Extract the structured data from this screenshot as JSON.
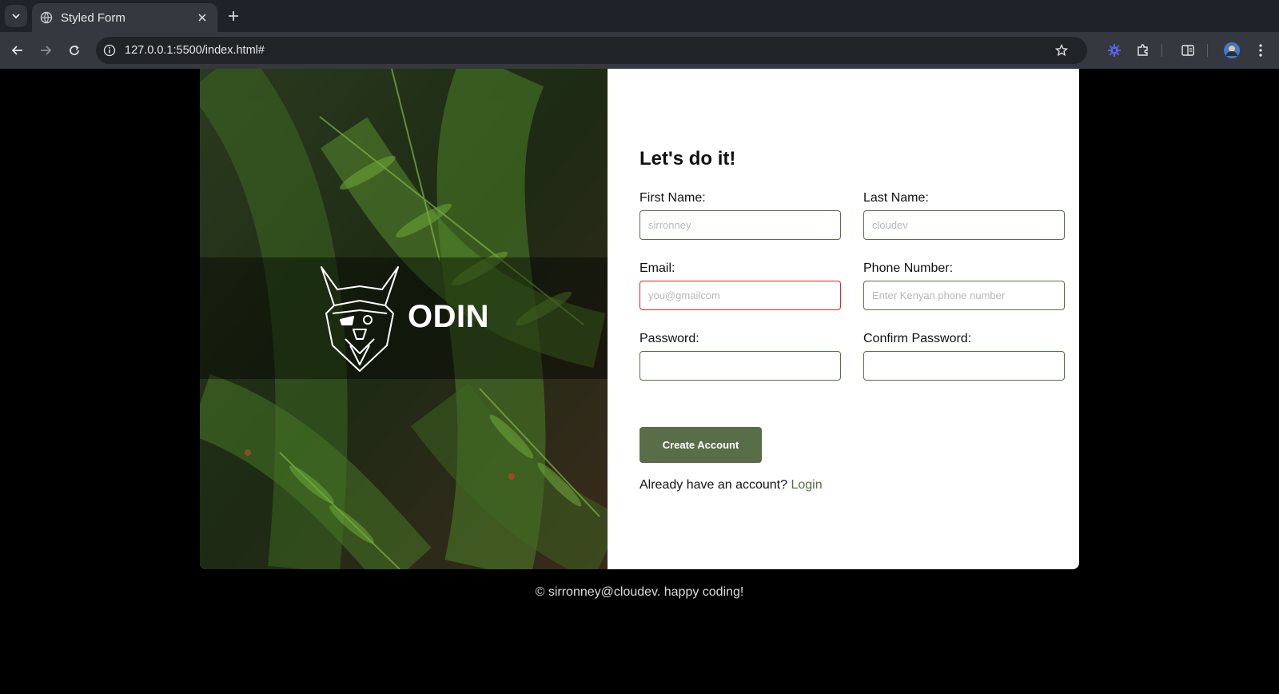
{
  "browser": {
    "tab_title": "Styled Form",
    "url": "127.0.0.1:5500/index.html#"
  },
  "hero": {
    "brand": "ODIN"
  },
  "form": {
    "heading": "Let's do it!",
    "fields": {
      "first_name": {
        "label": "First Name:",
        "placeholder": "sirronney",
        "value": ""
      },
      "last_name": {
        "label": "Last Name:",
        "placeholder": "cloudev",
        "value": ""
      },
      "email": {
        "label": "Email:",
        "placeholder": "you@gmailcom",
        "value": "",
        "state": "invalid"
      },
      "phone": {
        "label": "Phone Number:",
        "placeholder": "Enter Kenyan phone number",
        "value": ""
      },
      "password": {
        "label": "Password:",
        "placeholder": "",
        "value": ""
      },
      "confirm_password": {
        "label": "Confirm Password:",
        "placeholder": "",
        "value": ""
      }
    },
    "submit_label": "Create Account",
    "signin_prompt": "Already have an account?",
    "signin_link": "Login"
  },
  "footer": {
    "text": "© sirronney@cloudev. happy coding!"
  },
  "colors": {
    "accent": "#596d48",
    "invalid": "#e0202a",
    "chrome_bg": "#35393f"
  }
}
